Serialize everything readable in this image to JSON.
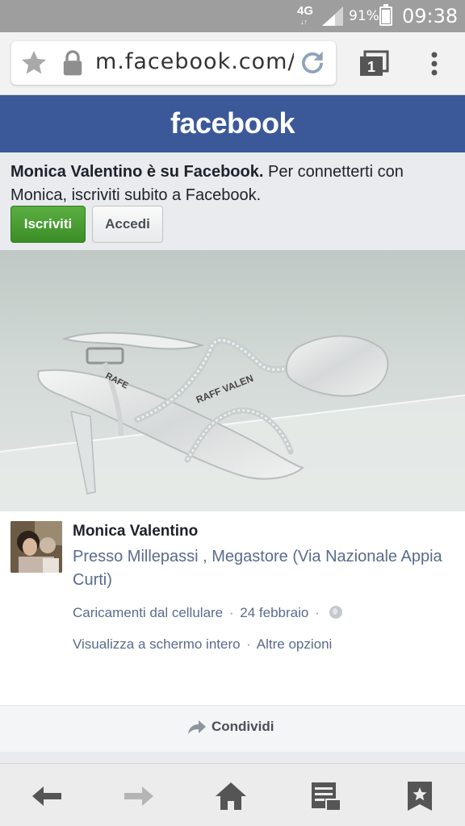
{
  "status_bar": {
    "network": "4G",
    "network_sub": "↓↑",
    "battery_percent": "91%",
    "battery_level": 0.91,
    "time": "09:38"
  },
  "browser": {
    "url": "m.facebook.com/p",
    "tab_count": "1",
    "icons": [
      "star-icon",
      "lock-icon",
      "reload-icon",
      "tabs-icon",
      "menu-dots-icon"
    ]
  },
  "facebook": {
    "logo": "facebook",
    "brand_color": "#3b5998"
  },
  "banner": {
    "bold_text": "Monica Valentino è su Facebook.",
    "text": " Per connetterti con Monica, iscriviti subito a Facebook.",
    "signup_label": "Iscriviti",
    "login_label": "Accedi"
  },
  "photo": {
    "brand_left": "RAFE",
    "brand_right": "RAFF VALEN"
  },
  "post": {
    "author": "Monica Valentino",
    "place": "Presso Millepassi , Megastore (Via Nazionale Appia Curti)",
    "source": "Caricamenti dal cellulare",
    "date": "24 febbraio",
    "separator": "·",
    "fullscreen_link": "Visualizza a schermo intero",
    "options_link": "Altre opzioni"
  },
  "share": {
    "label": "Condividi"
  },
  "bottom_nav": {
    "icons": [
      "back-arrow-icon",
      "forward-arrow-icon",
      "home-icon",
      "reader-icon",
      "bookmarks-icon"
    ]
  }
}
